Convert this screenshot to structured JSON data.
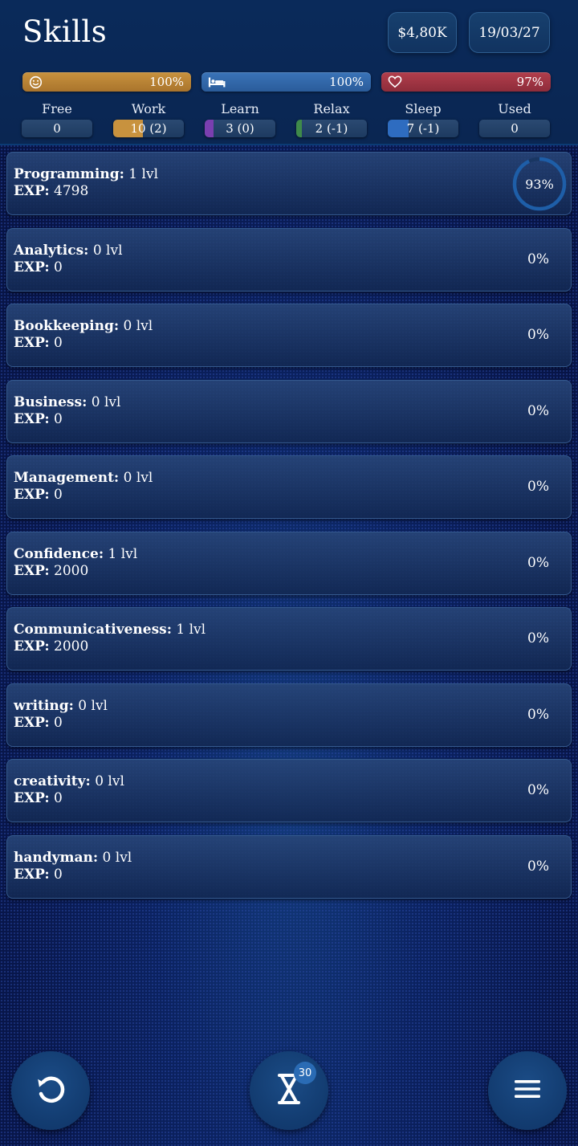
{
  "header": {
    "title": "Skills",
    "money": "$4,80K",
    "date": "19/03/27"
  },
  "bars": {
    "mood": {
      "value": "100%",
      "icon": "smiley-icon",
      "fill": 1.0
    },
    "energy": {
      "value": "100%",
      "icon": "bed-icon",
      "fill": 1.0
    },
    "health": {
      "value": "97%",
      "icon": "heart-icon",
      "fill": 0.97
    }
  },
  "stats": [
    {
      "label": "Free",
      "value": "0",
      "fill": 0,
      "color": "#3b5578"
    },
    {
      "label": "Work",
      "value": "10 (2)",
      "fill": 0.42,
      "color": "#c8923e"
    },
    {
      "label": "Learn",
      "value": "3 (0)",
      "fill": 0.12,
      "color": "#7a3fb0"
    },
    {
      "label": "Relax",
      "value": "2 (-1)",
      "fill": 0.08,
      "color": "#3f8a4a"
    },
    {
      "label": "Sleep",
      "value": "7 (-1)",
      "fill": 0.3,
      "color": "#2e6cc0"
    },
    {
      "label": "Used",
      "value": "0",
      "fill": 0,
      "color": "#3b5578"
    }
  ],
  "skills": [
    {
      "name": "Programming:",
      "level": " 1 lvl",
      "exp_label": "EXP:",
      "exp": " 4798",
      "progress": "93%",
      "ring": 0.93
    },
    {
      "name": "Analytics:",
      "level": " 0 lvl",
      "exp_label": "EXP:",
      "exp": " 0",
      "progress": "0%"
    },
    {
      "name": "Bookkeeping:",
      "level": " 0 lvl",
      "exp_label": "EXP:",
      "exp": " 0",
      "progress": "0%"
    },
    {
      "name": "Business:",
      "level": " 0 lvl",
      "exp_label": "EXP:",
      "exp": " 0",
      "progress": "0%"
    },
    {
      "name": "Management:",
      "level": " 0 lvl",
      "exp_label": "EXP:",
      "exp": " 0",
      "progress": "0%"
    },
    {
      "name": "Confidence:",
      "level": " 1 lvl",
      "exp_label": "EXP:",
      "exp": " 2000",
      "progress": "0%"
    },
    {
      "name": "Communicativeness:",
      "level": " 1 lvl",
      "exp_label": "EXP:",
      "exp": " 2000",
      "progress": "0%"
    },
    {
      "name": "writing:",
      "level": " 0 lvl",
      "exp_label": "EXP:",
      "exp": " 0",
      "progress": "0%"
    },
    {
      "name": "creativity:",
      "level": " 0 lvl",
      "exp_label": "EXP:",
      "exp": " 0",
      "progress": "0%"
    },
    {
      "name": "handyman:",
      "level": " 0 lvl",
      "exp_label": "EXP:",
      "exp": " 0",
      "progress": "0%"
    }
  ],
  "bottom": {
    "undo_icon": "undo-icon",
    "time_icon": "hourglass-icon",
    "time_badge": "30",
    "menu_icon": "hamburger-menu-icon"
  }
}
